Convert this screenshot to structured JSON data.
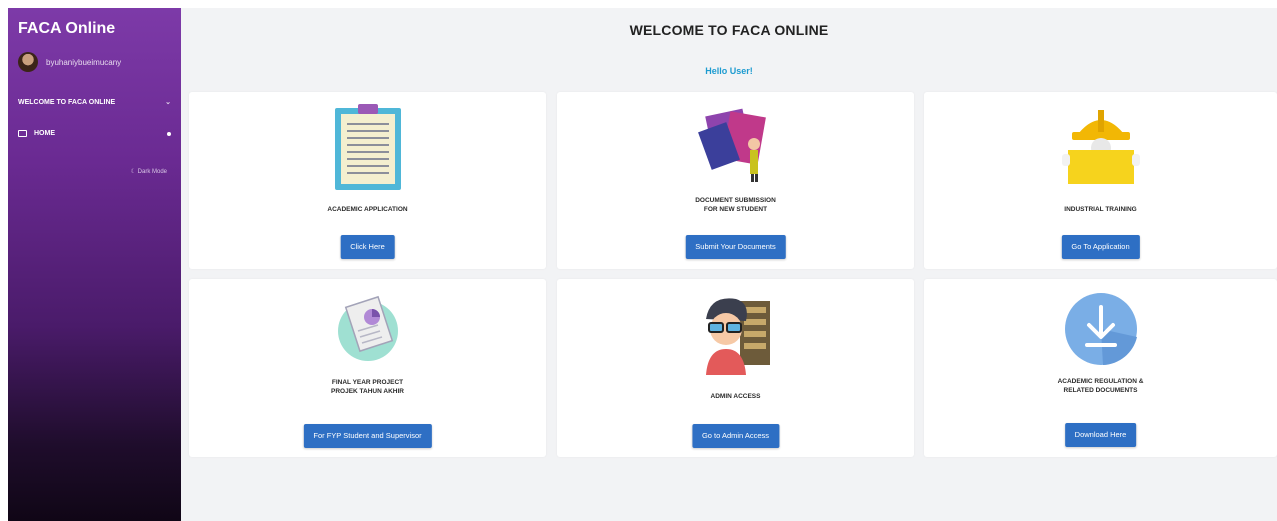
{
  "sidebar": {
    "brand": "FACA Online",
    "username": "byuhaniybueimucany",
    "nav_welcome": "WELCOME TO FACA ONLINE",
    "nav_home": "HOME",
    "dark_mode": "Dark Mode"
  },
  "main": {
    "title": "WELCOME TO FACA ONLINE",
    "greeting": "Hello User!"
  },
  "cards": [
    {
      "label": "ACADEMIC APPLICATION",
      "button": "Click Here",
      "icon": "clipboard-icon"
    },
    {
      "label": "DOCUMENT SUBMISSION\nFOR NEW STUDENT",
      "button": "Submit Your Documents",
      "icon": "documents-icon"
    },
    {
      "label": "INDUSTRIAL TRAINING",
      "button": "Go To Application",
      "icon": "worker-helmet-icon"
    },
    {
      "label": "FINAL YEAR PROJECT\nPROJEK TAHUN AKHIR",
      "button": "For FYP Student and Supervisor",
      "icon": "report-icon"
    },
    {
      "label": "ADMIN ACCESS",
      "button": "Go to Admin Access",
      "icon": "admin-icon"
    },
    {
      "label": "ACADEMIC REGULATION &\nRELATED DOCUMENTS",
      "button": "Download Here",
      "icon": "download-icon"
    }
  ],
  "colors": {
    "button": "#2e6fc4",
    "greeting": "#1d9bd0",
    "sidebar_top": "#7d3aa8",
    "sidebar_bottom": "#100616"
  }
}
